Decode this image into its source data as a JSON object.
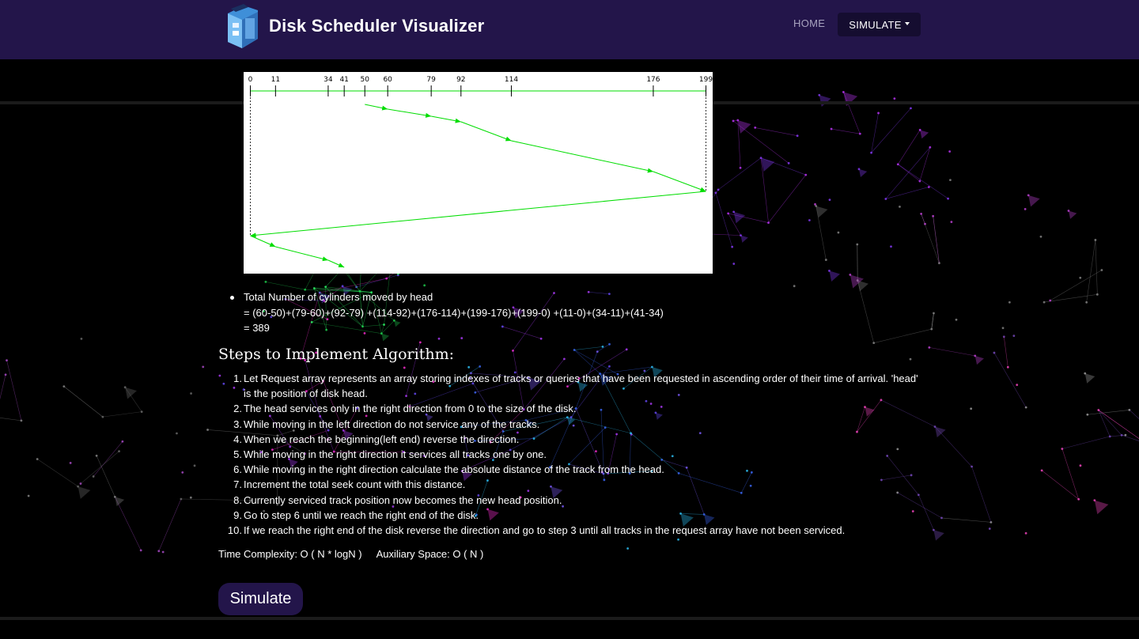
{
  "navbar": {
    "brand_title": "Disk Scheduler Visualizer",
    "home_label": "HOME",
    "simulate_label": "SIMULATE",
    "bg_color": "#23154a"
  },
  "chart_data": {
    "type": "line",
    "ticks": [
      0,
      11,
      34,
      41,
      50,
      60,
      79,
      92,
      114,
      176,
      199
    ],
    "xlim": [
      0,
      199
    ],
    "head_path": [
      50,
      60,
      79,
      92,
      114,
      176,
      199,
      0,
      11,
      34,
      41
    ],
    "line_color": "#00dd00"
  },
  "total": {
    "label": "Total Number of cylinders moved by head",
    "formula": "= (60-50)+(79-60)+(92-79) +(114-92)+(176-114)+(199-176)+(199-0) +(11-0)+(34-11)+(41-34)",
    "result": "= 389"
  },
  "steps_title": "Steps to Implement Algorithm:",
  "steps": [
    "Let Request array represents an array storing indexes of tracks or queries that have been requested in ascending order of their time of arrival. 'head' is the position of disk head.",
    "The head services only in the right direction from 0 to the size of the disk.",
    "While moving in the left direction do not service any of the tracks.",
    "When we reach the beginning(left end) reverse the direction.",
    "While moving in the right direction it services all tracks one by one.",
    "While moving in the right direction calculate the absolute distance of the track from the head.",
    "Increment the total seek count with this distance.",
    "Currently serviced track position now becomes the new head position.",
    "Go to step 6 until we reach the right end of the disk.",
    "If we reach the right end of the disk reverse the direction and go to step 3 until all tracks in the request array have not been serviced."
  ],
  "complexity": {
    "time": "Time Complexity: O ( N * logN )",
    "space": "Auxiliary Space: O ( N )"
  },
  "simulate_button": "Simulate"
}
